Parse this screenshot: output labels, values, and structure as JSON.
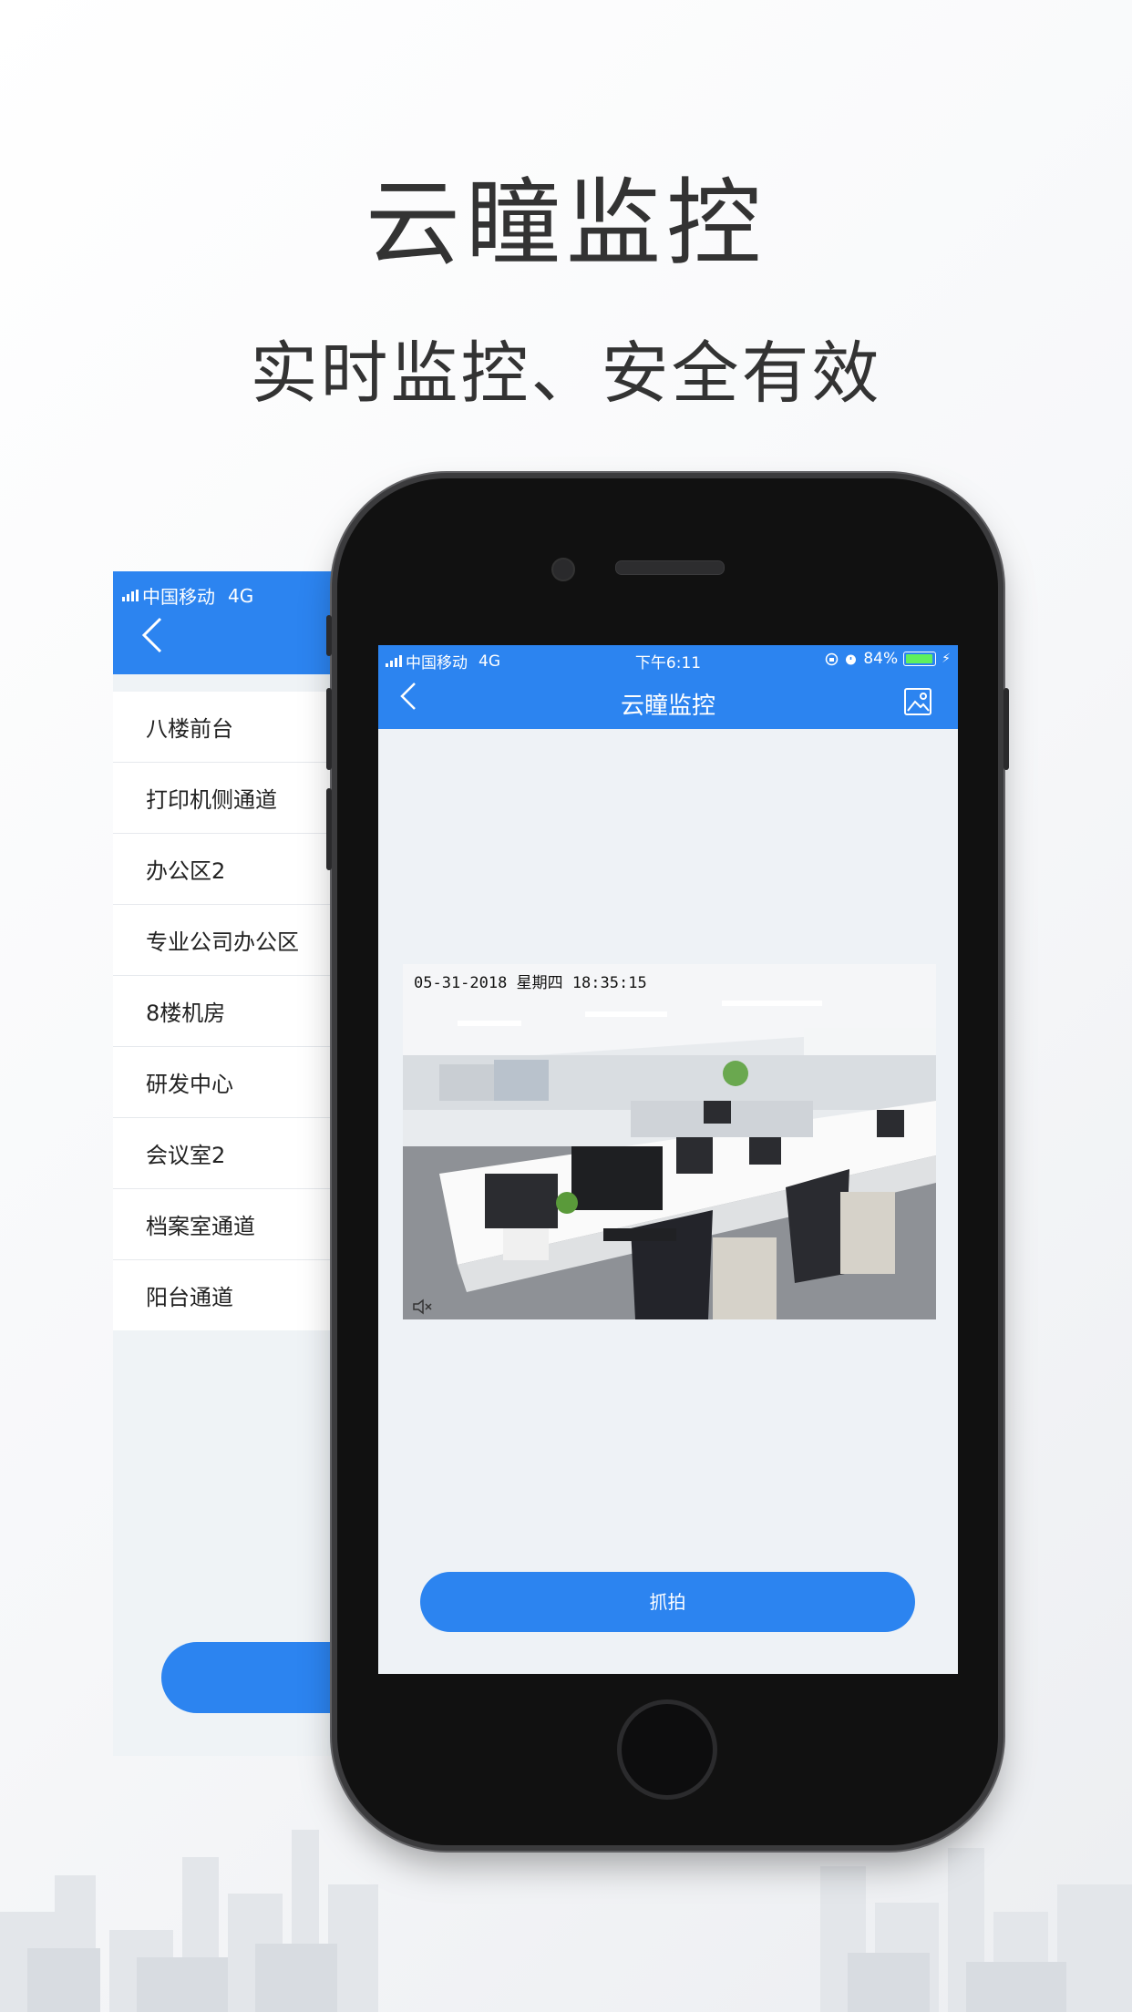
{
  "promo": {
    "title": "云瞳监控",
    "subtitle": "实时监控、安全有效"
  },
  "back_screen": {
    "carrier": "中国移动",
    "network": "4G",
    "camera_list": [
      "八楼前台",
      "打印机侧通道",
      "办公区2",
      "专业公司办公区",
      "8楼机房",
      "研发中心",
      "会议室2",
      "档案室通道",
      "阳台通道"
    ]
  },
  "status_bar": {
    "carrier": "中国移动",
    "network": "4G",
    "time": "下午6:11",
    "battery": "84%",
    "battery_color": "#5ef05e"
  },
  "nav": {
    "title": "云瞳监控",
    "back_icon": "chevron-left-icon",
    "right_icon": "gallery-icon"
  },
  "video": {
    "timestamp": "05-31-2018 星期四 18:35:15",
    "mute_icon": "mute-icon"
  },
  "capture_button": {
    "label": "抓拍"
  },
  "colors": {
    "accent": "#2c84f0",
    "screen_bg": "#eef2f6"
  }
}
